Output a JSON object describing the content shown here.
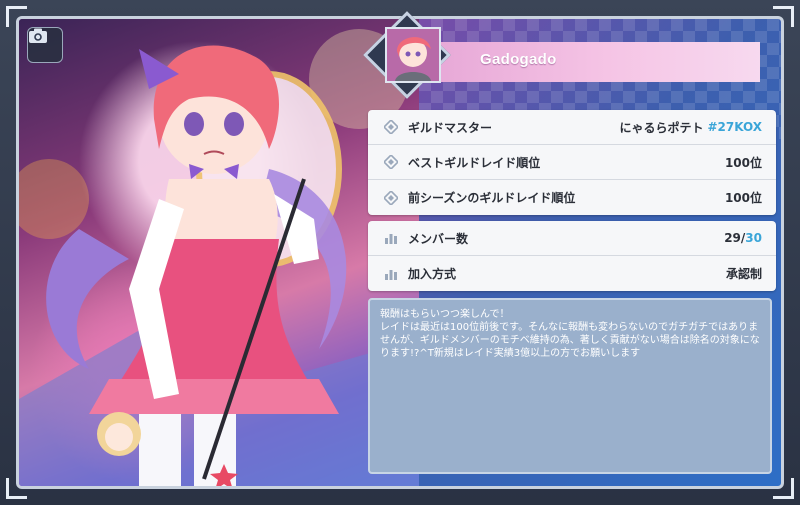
{
  "guild": {
    "name": "Gadogado"
  },
  "info_rows": [
    {
      "label": "ギルドマスター",
      "value": "にゃるらポテト",
      "tag": "#27KOX"
    },
    {
      "label": "ベストギルドレイド順位",
      "value": "100位"
    },
    {
      "label": "前シーズンのギルドレイド順位",
      "value": "100位"
    }
  ],
  "stats_rows": {
    "members": {
      "label": "メンバー数",
      "current": "29",
      "separator": "/",
      "max": "30"
    },
    "join": {
      "label": "加入方式",
      "value": "承認制"
    }
  },
  "description": "報酬はもらいつつ楽しんで！\nレイドは最近は100位前後です。そんなに報酬も変わらないのでガチガチではありませんが、ギルドメンバーのモチベ維持の為、著しく貢献がない場合は除名の対象になります!?^T新規はレイド実績3億以上の方でお願いします",
  "icons": {
    "camera": "camera-icon",
    "diamond": "diamond-bullet-icon",
    "stats": "bar-chart-icon"
  },
  "colors": {
    "header_pink": "#f5c4e5",
    "tag_blue": "#3aa5d8",
    "description_bg": "#9ab0cc"
  }
}
